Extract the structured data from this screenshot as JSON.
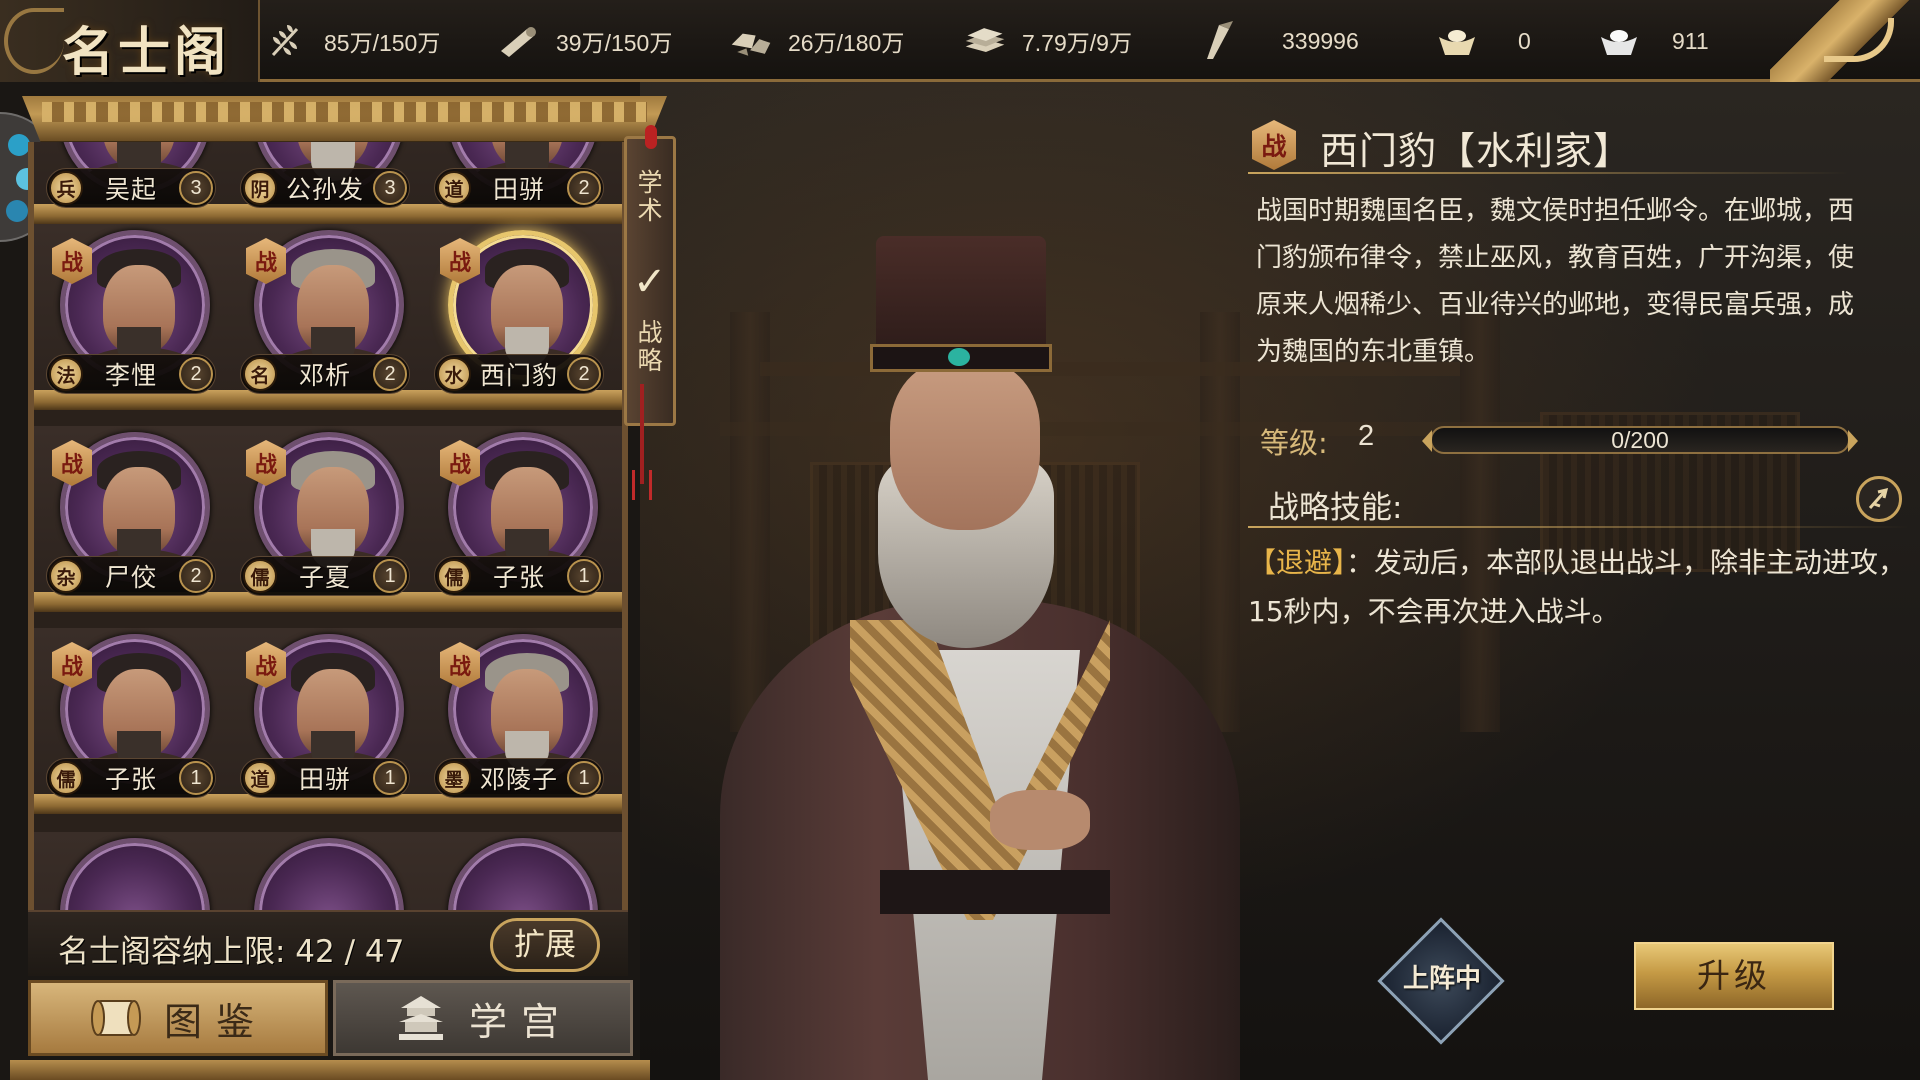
{
  "app": {
    "title": "名士阁"
  },
  "resources": [
    {
      "icon": "wheat-icon",
      "value": "85万/150万"
    },
    {
      "icon": "wood-icon",
      "value": "39万/150万"
    },
    {
      "icon": "stone-icon",
      "value": "26万/180万"
    },
    {
      "icon": "iron-icon",
      "value": "7.79万/9万"
    },
    {
      "icon": "silk-icon",
      "value": "339996"
    },
    {
      "icon": "gold-ingot-icon",
      "value": "0"
    },
    {
      "icon": "silver-ingot-icon",
      "value": "911"
    }
  ],
  "shelf": {
    "side_tab": {
      "top": "学术",
      "bottom": "战略"
    },
    "war_badge": "战",
    "rows": [
      [
        {
          "school": "兵",
          "name": "吴起",
          "level": "3",
          "has_war": false
        },
        {
          "school": "阴",
          "name": "公孙发",
          "level": "3",
          "has_war": false
        },
        {
          "school": "道",
          "name": "田骈",
          "level": "2",
          "has_war": false
        }
      ],
      [
        {
          "school": "法",
          "name": "李悝",
          "level": "2",
          "has_war": true
        },
        {
          "school": "名",
          "name": "邓析",
          "level": "2",
          "has_war": true
        },
        {
          "school": "水",
          "name": "西门豹",
          "level": "2",
          "has_war": true,
          "selected": true
        }
      ],
      [
        {
          "school": "杂",
          "name": "尸佼",
          "level": "2",
          "has_war": true
        },
        {
          "school": "儒",
          "name": "子夏",
          "level": "1",
          "has_war": true
        },
        {
          "school": "儒",
          "name": "子张",
          "level": "1",
          "has_war": true
        }
      ],
      [
        {
          "school": "儒",
          "name": "子张",
          "level": "1",
          "has_war": true
        },
        {
          "school": "道",
          "name": "田骈",
          "level": "1",
          "has_war": true
        },
        {
          "school": "墨",
          "name": "邓陵子",
          "level": "1",
          "has_war": true
        }
      ]
    ],
    "capacity_label": "名士阁容纳上限: 42 / 47",
    "expand_label": "扩展"
  },
  "bottom_tabs": {
    "gallery": "图鉴",
    "academy": "学宫"
  },
  "detail": {
    "badge": "战",
    "title": "西门豹【水利家】",
    "description": "战国时期魏国名臣，魏文侯时担任邺令。在邺城，西门豹颁布律令，禁止巫风，教育百姓，广开沟渠，使原来人烟稀少、百业待兴的邺地，变得民富兵强，成为魏国的东北重镇。",
    "level_label": "等级:",
    "level_value": "2",
    "exp_text": "0/200",
    "exp_fraction": 0,
    "skill_label": "战略技能:",
    "skill_name": "【退避】",
    "skill_desc": "：发动后，本部队退出战斗，除非主动进攻，15秒内，不会再次进入战斗。"
  },
  "actions": {
    "deployed": "上阵中",
    "upgrade": "升级"
  },
  "colors": {
    "accent_gold": "#c9a45d",
    "skill_name": "#e8b54a",
    "selected_ring": "#e7c66c"
  }
}
